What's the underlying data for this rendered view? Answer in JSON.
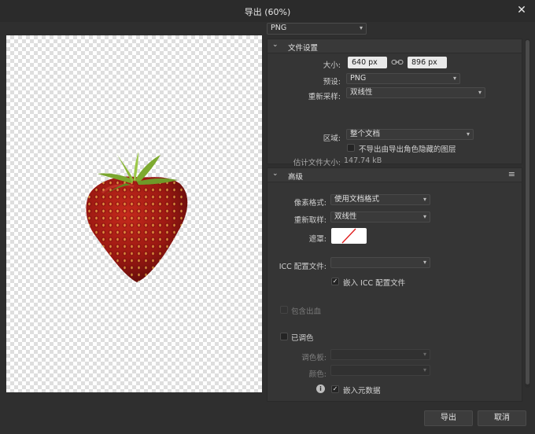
{
  "window": {
    "title": "导出 (60%)"
  },
  "format": {
    "value": "PNG"
  },
  "file_settings": {
    "header": "文件设置",
    "size_label": "大小:",
    "width": "640 px",
    "height": "896 px",
    "preset_label": "预设:",
    "preset_value": "PNG",
    "resample_label": "重新采样:",
    "resample_value": "双线性",
    "area_label": "区域:",
    "area_value": "整个文档",
    "hidden_layers_label": "不导出由导出角色隐藏的图层",
    "estimate_label": "估计文件大小:",
    "estimate_value": "147.74 kB"
  },
  "advanced": {
    "header": "高级",
    "pixel_format_label": "像素格式:",
    "pixel_format_value": "使用文档格式",
    "resample_label": "重新取样:",
    "resample_value": "双线性",
    "matte_label": "遮罩:",
    "icc_label": "ICC 配置文件:",
    "icc_value": "",
    "embed_icc_label": "嵌入 ICC 配置文件",
    "include_bleed_label": "包含出血",
    "palettised_label": "已调色",
    "palette_label": "调色板:",
    "colors_label": "颜色:",
    "embed_metadata_label": "嵌入元数据"
  },
  "buttons": {
    "export": "导出",
    "cancel": "取消"
  },
  "colors": {
    "background": "#2f2f2f",
    "panel": "#353535",
    "field": "#e9e9e9",
    "matte_line": "#e02020"
  },
  "icons": {
    "close": "close-icon",
    "link": "link-icon",
    "info": "info-icon",
    "chevron": "chevron-down-icon",
    "menu": "panel-menu-icon"
  }
}
